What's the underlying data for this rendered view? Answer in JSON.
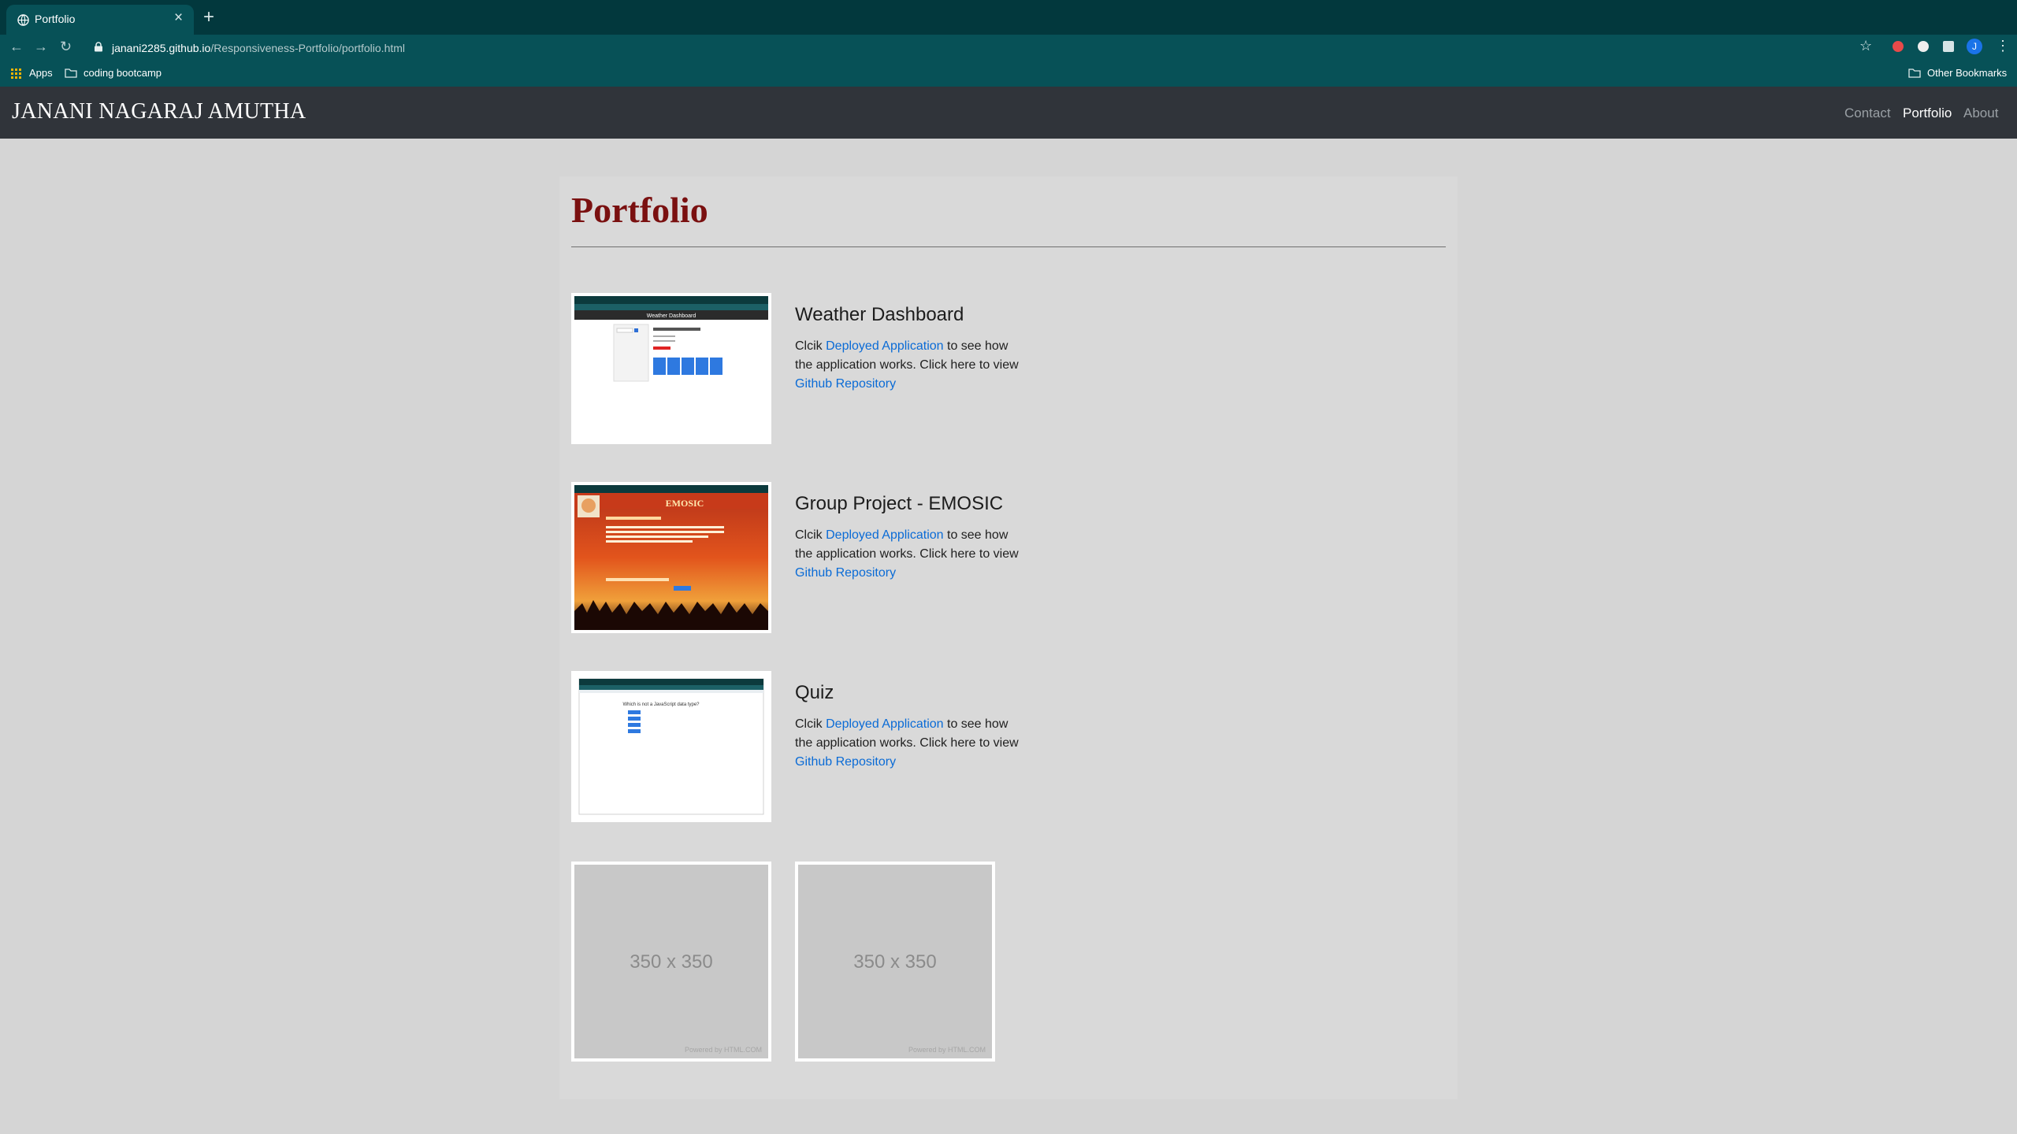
{
  "browser": {
    "tab_title": "Portfolio",
    "url_host": "janani2285.github.io",
    "url_path": "/Responsiveness-Portfolio/portfolio.html",
    "bookmarks": [
      {
        "label": "Apps",
        "icon": "apps-grid-icon"
      },
      {
        "label": "coding bootcamp",
        "icon": "folder-icon"
      }
    ],
    "other_bookmarks": "Other Bookmarks",
    "profile_initial": "J",
    "accent": "#075157"
  },
  "site": {
    "brand": "JANANI NAGARAJ AMUTHA",
    "nav": [
      {
        "label": "Contact",
        "active": false
      },
      {
        "label": "Portfolio",
        "active": true
      },
      {
        "label": "About",
        "active": false
      }
    ]
  },
  "page": {
    "title": "Portfolio",
    "title_color": "#7a1010",
    "projects": [
      {
        "title": "Weather Dashboard",
        "thumbnail": "weather-dashboard-screenshot",
        "thumb_heading": "Weather Dashboard",
        "desc_prefix": "Clcik ",
        "link1": "Deployed Application",
        "desc_middle": " to see how the application works. Click here to view ",
        "link2": "Github Repository"
      },
      {
        "title": "Group Project - EMOSIC",
        "thumbnail": "emosic-screenshot",
        "thumb_heading": "EMOSIC",
        "desc_prefix": "Clcik ",
        "link1": "Deployed Application",
        "desc_middle": " to see how the application works. Click here to view ",
        "link2": "Github Repository"
      },
      {
        "title": "Quiz",
        "thumbnail": "quiz-screenshot",
        "thumb_heading": "Which is not a JavaScript data type?",
        "desc_prefix": "Clcik ",
        "link1": "Deployed Application",
        "desc_middle": " to see how the application works. Click here to view ",
        "link2": "Github Repository"
      }
    ],
    "placeholders": [
      {
        "label": "350 x 350",
        "footer": "Powered by HTML.COM"
      },
      {
        "label": "350 x 350",
        "footer": "Powered by HTML.COM"
      }
    ]
  }
}
